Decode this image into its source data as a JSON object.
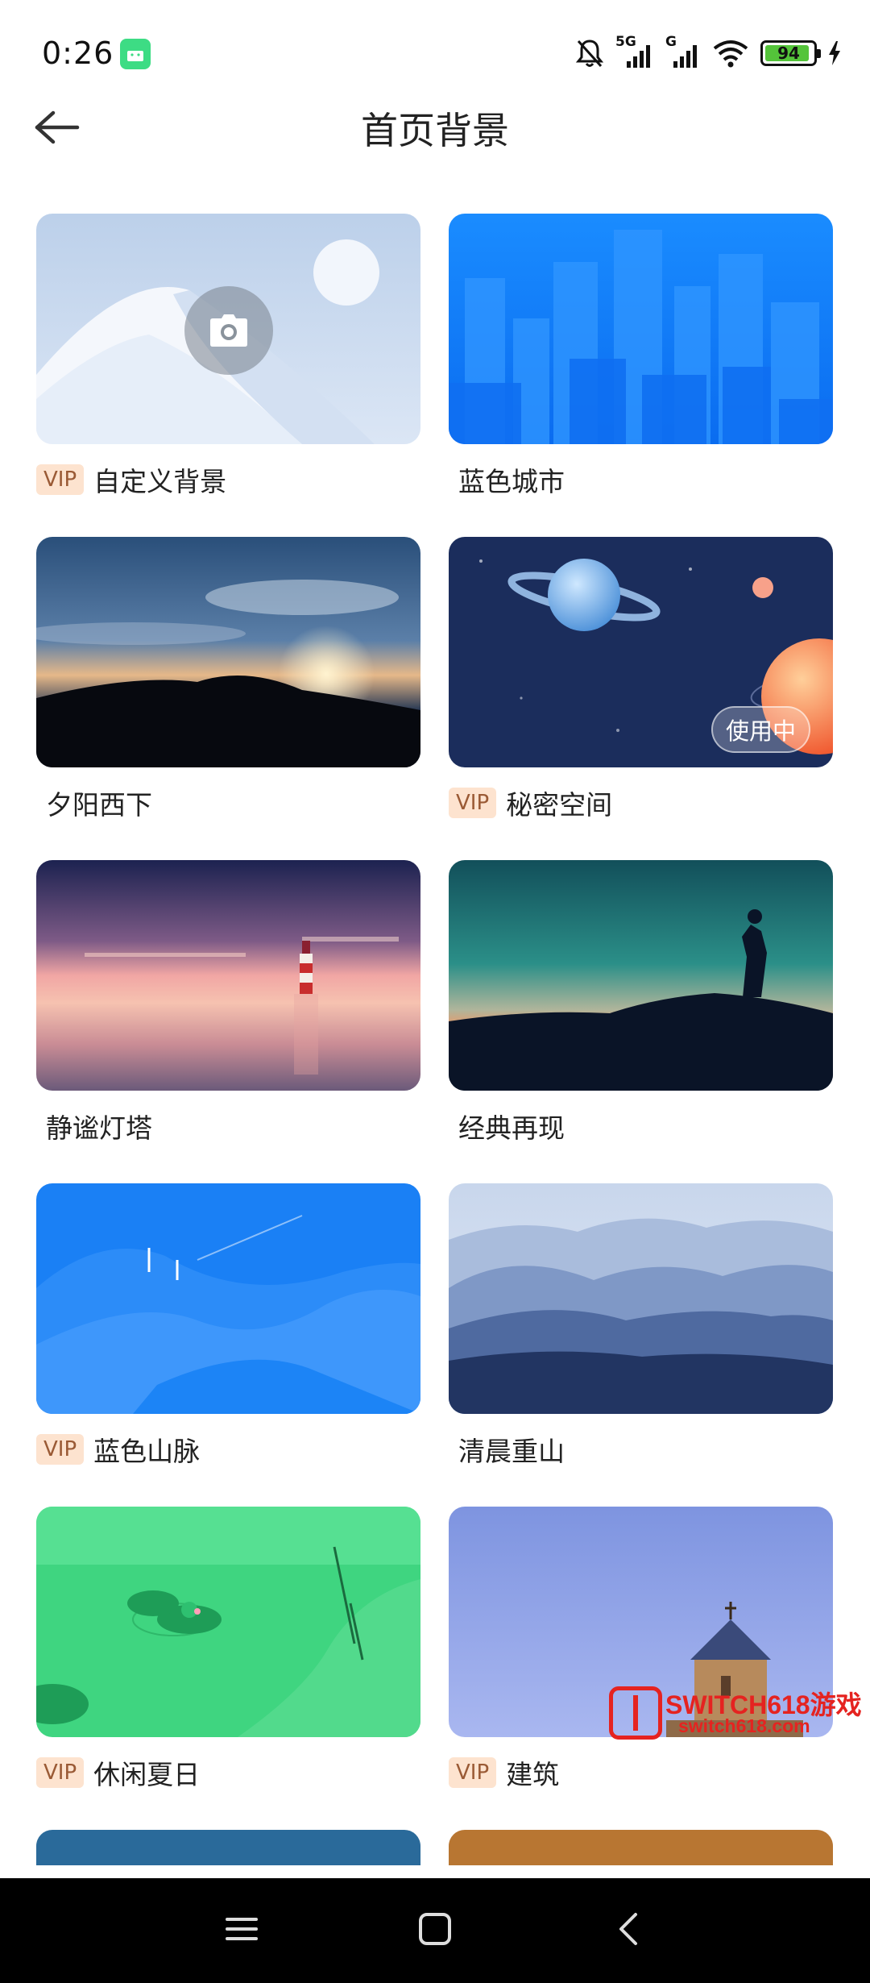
{
  "status_bar": {
    "time": "0:26",
    "network_1": "5G",
    "network_2": "G",
    "battery_percent": "94",
    "battery_level": 0.94,
    "icons": [
      "android-notification-icon",
      "bell-muted-icon",
      "signal-icon",
      "signal-icon",
      "wifi-icon",
      "battery-icon",
      "charging-icon"
    ]
  },
  "header": {
    "title": "首页背景",
    "back_icon": "arrow-left-icon"
  },
  "vip_label": "VIP",
  "in_use_label": "使用中",
  "wallpapers": [
    {
      "label": "自定义背景",
      "vip": true
    },
    {
      "label": "蓝色城市",
      "vip": false
    },
    {
      "label": "夕阳西下",
      "vip": false
    },
    {
      "label": "秘密空间",
      "vip": true,
      "in_use": true
    },
    {
      "label": "静谧灯塔",
      "vip": false
    },
    {
      "label": "经典再现",
      "vip": false
    },
    {
      "label": "蓝色山脉",
      "vip": true
    },
    {
      "label": "清晨重山",
      "vip": false
    },
    {
      "label": "休闲夏日",
      "vip": true
    },
    {
      "label": "建筑",
      "vip": true
    }
  ],
  "watermark": {
    "title": "SWITCH618游戏",
    "subtitle": "switch618.com"
  },
  "nav_bar": {
    "icons": [
      "menu-icon",
      "home-icon",
      "back-icon"
    ]
  },
  "colors": {
    "vip_bg": "#fde3cf",
    "vip_text": "#9a5a35",
    "watermark": "#e52320"
  }
}
